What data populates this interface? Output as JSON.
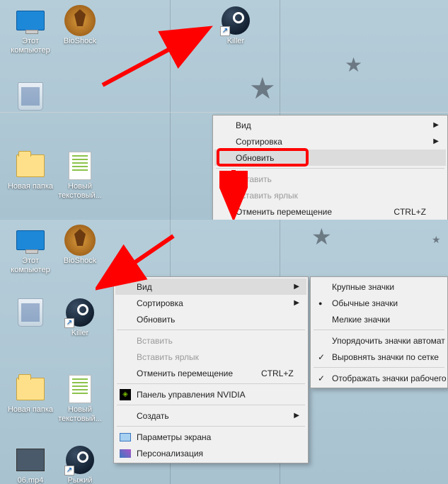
{
  "top": {
    "icons": {
      "computer": "Этот компьютер",
      "bioshock": "BioShock",
      "killer": "Killer",
      "new_folder": "Новая папка",
      "new_text": "Новый текстовый..."
    },
    "menu": {
      "view": "Вид",
      "sort": "Сортировка",
      "refresh": "Обновить",
      "paste": "Вставить",
      "paste_shortcut": "Вставить ярлык",
      "undo_move": "Отменить перемещение",
      "undo_shortcut": "CTRL+Z"
    }
  },
  "bottom": {
    "icons": {
      "computer": "Этот компьютер",
      "bioshock": "BioShock",
      "killer": "Killer",
      "new_folder": "Новая папка",
      "new_text": "Новый текстовый...",
      "video": "06.mp4",
      "ryzhiy": "Рыжий"
    },
    "menu": {
      "view": "Вид",
      "sort": "Сортировка",
      "refresh": "Обновить",
      "paste": "Вставить",
      "paste_shortcut": "Вставить ярлык",
      "undo_move": "Отменить перемещение",
      "undo_shortcut": "CTRL+Z",
      "nvidia": "Панель управления NVIDIA",
      "create": "Создать",
      "display": "Параметры экрана",
      "personalize": "Персонализация"
    },
    "submenu": {
      "large": "Крупные значки",
      "medium": "Обычные значки",
      "small": "Мелкие значки",
      "auto": "Упорядочить значки автомат",
      "grid": "Выровнять значки по сетке",
      "show": "Отображать значки рабочего"
    }
  }
}
